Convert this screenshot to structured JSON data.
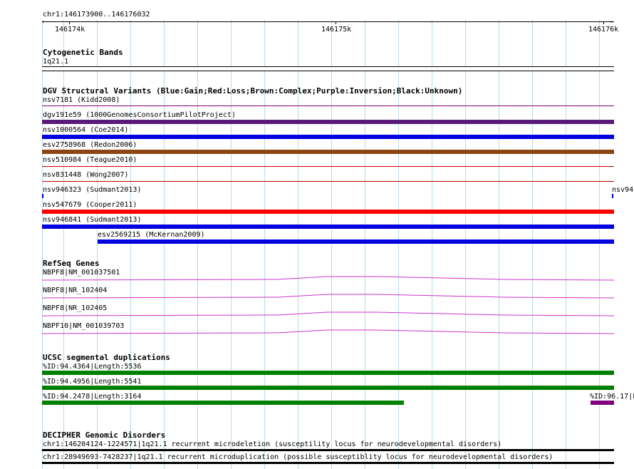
{
  "ruler": {
    "location": "chr1:146173900..146176032",
    "ticks": [
      "146174k",
      "146175k",
      "146176k"
    ]
  },
  "cytoband": {
    "title": "Cytogenetic Bands",
    "band": "1q21.1"
  },
  "dgv": {
    "title": "DGV Structural Variants (Blue:Gain;Red:Loss;Brown:Complex;Purple:Inversion;Black:Unknown)",
    "items": [
      {
        "label": "nsv7181 (Kidd2008)",
        "color": "#800080",
        "style": "thin"
      },
      {
        "label": "dgv191e59 (1000GenomesConsortiumPilotProject)",
        "color": "#5a1a7a",
        "style": "thick"
      },
      {
        "label": "nsv1000564 (Coe2014)",
        "color": "#0000e0",
        "style": "thick"
      },
      {
        "label": "esv2758968 (Redon2006)",
        "color": "#8b4513",
        "style": "thick"
      },
      {
        "label": "nsv510984 (Teague2010)",
        "color": "#cc0000",
        "style": "thin"
      },
      {
        "label": "nsv831448 (Wong2007)",
        "color": "#cc0000",
        "style": "thin"
      },
      {
        "label": "nsv946323 (Sudmant2013)",
        "color": "#0000e0",
        "style": "tick",
        "right_label": "nsv94"
      },
      {
        "label": "nsv547679 (Cooper2011)",
        "color": "#ff0000",
        "style": "thick"
      },
      {
        "label": "nsv946841 (Sudmant2013)",
        "color": "#0000e0",
        "style": "thick"
      },
      {
        "label": "esv2569215 (McKernan2009)",
        "color": "#0000e0",
        "style": "thick"
      }
    ]
  },
  "refseq": {
    "title": "RefSeq Genes",
    "genes": [
      "NBPF8|NM_001037501",
      "NBPF8|NR_102404",
      "NBPF8|NR_102405",
      "NBPF10|NM_001039703"
    ],
    "color": "#cc33cc"
  },
  "segdups": {
    "title": "UCSC segmental duplications",
    "items": [
      {
        "label": "%ID:94.4364|Length:5536",
        "color": "#008000"
      },
      {
        "label": "%ID:94.4956|Length:5541",
        "color": "#008000"
      },
      {
        "label": "%ID:94.2478|Length:3164",
        "color": "#008000",
        "right_label": "%ID:96.17|L",
        "right_color": "#800080"
      }
    ]
  },
  "decipher": {
    "title": "DECIPHER Genomic Disorders",
    "items": [
      "chr1:146204124-1224571|1q21.1 recurrent microdeletion (susceptility locus for neurodevelopmental disorders)",
      "chr1:28949693-7428237|1q21.1 recurrent microduplication (possible susceptiblity locus for neurodevelopmental disorders)"
    ]
  }
}
